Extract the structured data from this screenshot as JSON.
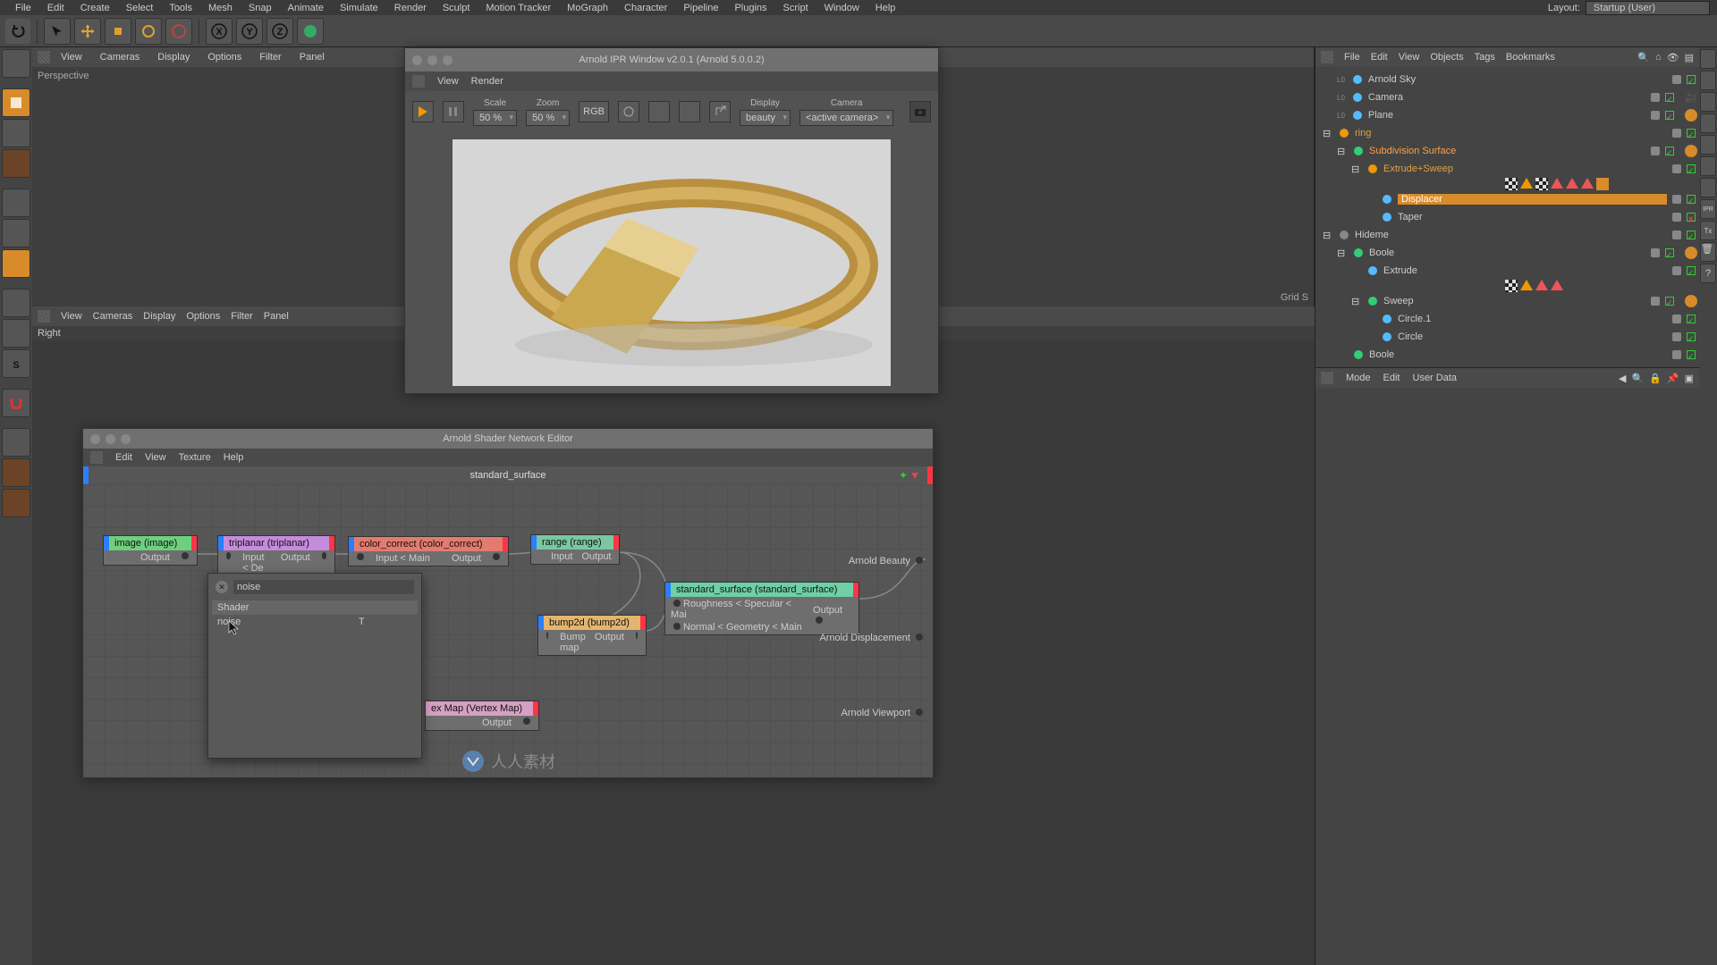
{
  "menubar": {
    "items": [
      "File",
      "Edit",
      "Create",
      "Select",
      "Tools",
      "Mesh",
      "Snap",
      "Animate",
      "Simulate",
      "Render",
      "Sculpt",
      "Motion Tracker",
      "MoGraph",
      "Character",
      "Pipeline",
      "Plugins",
      "Script",
      "Window",
      "Help"
    ],
    "layout_label": "Layout:",
    "layout_value": "Startup (User)"
  },
  "viewport1": {
    "menus": [
      "View",
      "Cameras",
      "Display",
      "Options",
      "Filter",
      "Panel"
    ],
    "label": "Perspective",
    "footer": "Grid S"
  },
  "viewport2": {
    "menus": [
      "View",
      "Cameras",
      "Display",
      "Options",
      "Filter",
      "Panel"
    ],
    "label": "Right"
  },
  "ipr": {
    "title": "Arnold IPR Window v2.0.1 (Arnold 5.0.0.2)",
    "menus": [
      "View",
      "Render"
    ],
    "scale_label": "Scale",
    "scale_value": "50 %",
    "zoom_label": "Zoom",
    "zoom_value": "50 %",
    "rgb_label": "RGB",
    "display_label": "Display",
    "display_value": "beauty",
    "camera_label": "Camera",
    "camera_value": "<active camera>"
  },
  "shader_editor": {
    "title": "Arnold Shader Network Editor",
    "menus": [
      "Edit",
      "View",
      "Texture",
      "Help"
    ],
    "tab": "standard_surface",
    "nodes": {
      "image": {
        "head": "image (image)",
        "out": "Output"
      },
      "triplanar": {
        "head": "triplanar (triplanar)",
        "in": "Input < De",
        "out": "Output"
      },
      "color_correct": {
        "head": "color_correct (color_correct)",
        "in": "Input < Main",
        "out": "Output"
      },
      "range": {
        "head": "range (range)",
        "in": "Input",
        "out": "Output"
      },
      "bump2d": {
        "head": "bump2d (bump2d)",
        "in": "Bump map",
        "out": "Output"
      },
      "standard_surface": {
        "head": "standard_surface (standard_surface)",
        "row1": "Roughness < Specular < Mai",
        "row2": "Normal < Geometry < Main",
        "out": "Output"
      },
      "vertex_map": {
        "head": "ex Map (Vertex Map)",
        "out": "Output"
      }
    },
    "outputs": {
      "beauty": "Arnold Beauty",
      "displacement": "Arnold Displacement",
      "viewport": "Arnold Viewport"
    },
    "search": {
      "placeholder": "",
      "value": "noise",
      "header": "Shader",
      "result": "noise",
      "col2": "T"
    }
  },
  "objects": {
    "menus": [
      "File",
      "Edit",
      "View",
      "Objects",
      "Tags",
      "Bookmarks"
    ],
    "tree": [
      {
        "depth": 0,
        "name": "Arnold Sky",
        "icon": "sky",
        "color": "#5bf"
      },
      {
        "depth": 0,
        "name": "Camera",
        "icon": "camera",
        "color": "#5bf",
        "extra": "cam"
      },
      {
        "depth": 0,
        "name": "Plane",
        "icon": "plane",
        "color": "#5bf",
        "tags": [
          "o"
        ]
      },
      {
        "depth": 0,
        "name": "ring",
        "icon": "group",
        "color": "#e90",
        "expand": "-"
      },
      {
        "depth": 1,
        "name": "Subdivision Surface",
        "icon": "subd",
        "color": "#3c7",
        "expand": "-",
        "tags": [
          "o"
        ],
        "sel": true
      },
      {
        "depth": 2,
        "name": "Extrude+Sweep",
        "icon": "sweep",
        "color": "#e90",
        "expand": "-",
        "tagrow": [
          "checker",
          "tri-o",
          "checker",
          "tri-r",
          "tri-r",
          "tri-r",
          "sq-o"
        ]
      },
      {
        "depth": 3,
        "name": "Displacer",
        "icon": "disp",
        "color": "#5bf",
        "sel2": true
      },
      {
        "depth": 3,
        "name": "Taper",
        "icon": "taper",
        "color": "#5bf",
        "red": true
      },
      {
        "depth": 0,
        "name": "Hideme",
        "icon": "group",
        "color": "#888",
        "expand": "-"
      },
      {
        "depth": 1,
        "name": "Boole",
        "icon": "boole",
        "color": "#3c7",
        "expand": "-",
        "tags": [
          "o"
        ]
      },
      {
        "depth": 2,
        "name": "Extrude",
        "icon": "extrude",
        "color": "#5bf",
        "tagrow": [
          "checker",
          "tri-o",
          "tri-r",
          "tri-r"
        ]
      },
      {
        "depth": 2,
        "name": "Sweep",
        "icon": "sweep",
        "color": "#3c7",
        "expand": "-",
        "tags": [
          "o"
        ]
      },
      {
        "depth": 3,
        "name": "Circle.1",
        "icon": "circle",
        "color": "#5bf"
      },
      {
        "depth": 3,
        "name": "Circle",
        "icon": "circle",
        "color": "#5bf"
      },
      {
        "depth": 1,
        "name": "Boole",
        "icon": "boole",
        "color": "#3c7"
      }
    ]
  },
  "attributes": {
    "menus": [
      "Mode",
      "Edit",
      "User Data"
    ]
  },
  "watermark": "人人素材"
}
